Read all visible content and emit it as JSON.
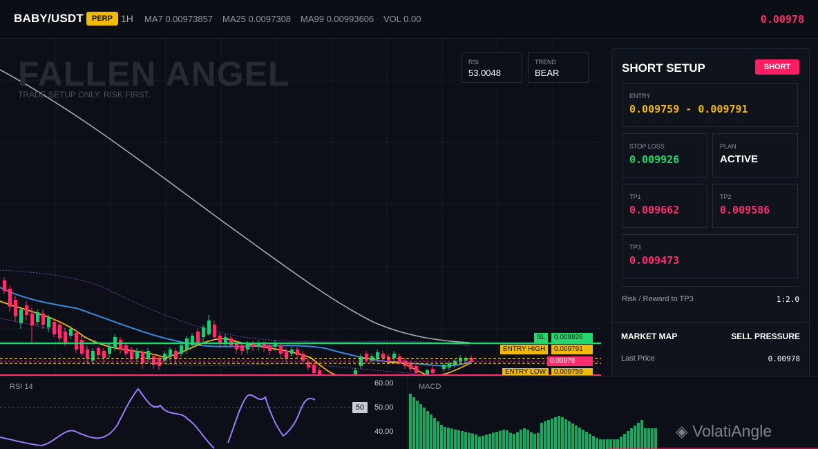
{
  "header": {
    "symbol": "BABY/USDT",
    "badge": "PERP",
    "timeframe": "1H",
    "ma7": "MA7 0.00973857",
    "ma25": "MA25 0.0097308",
    "ma99": "MA99 0.00993606",
    "vol": "VOL 0.00",
    "last_price": "0.00978"
  },
  "chart": {
    "watermark": "FALLEN ANGEL",
    "tagline": "TRADE SETUP ONLY. RISK FIRST.",
    "rsi_label": "RSI",
    "rsi_value": "53.0048",
    "trend_label": "TREND",
    "trend_value": "BEAR",
    "tags": {
      "sl": "SL",
      "sl_value": "0.009926",
      "entry_high": "ENTRY HIGH",
      "entry_high_value": "0.009791",
      "last": "0.00978",
      "entry_low": "ENTRY LOW",
      "entry_low_value": "0.009759"
    }
  },
  "setup": {
    "title": "SHORT SETUP",
    "direction": "SHORT",
    "entry_label": "ENTRY",
    "entry_value": "0.009759 - 0.009791",
    "sl_label": "STOP LOSS",
    "sl_value": "0.009926",
    "plan_label": "PLAN",
    "plan_value": "ACTIVE",
    "tp1_label": "TP1",
    "tp1_value": "0.009662",
    "tp2_label": "TP2",
    "tp2_value": "0.009586",
    "tp3_label": "TP3",
    "tp3_value": "0.009473",
    "rr_label": "Risk / Reward to TP3",
    "rr_value": "1:2.0"
  },
  "market_map": {
    "title": "MARKET MAP",
    "pressure": "SELL PRESSURE",
    "last_price_label": "Last Price",
    "last_price_value": "0.00978"
  },
  "indicators": {
    "rsi_title": "RSI 14",
    "rsi_axis_top": "60.00",
    "rsi_mid": "50",
    "rsi_axis_mid": "50.00",
    "rsi_axis_low": "40.00",
    "macd_title": "MACD"
  },
  "watermark_brand": "VolatiAngle",
  "colors": {
    "bg": "#0c0f17",
    "up": "#1ec97a",
    "down": "#ff2d6e",
    "accent": "#f0b90b",
    "sl": "#22d86a"
  }
}
